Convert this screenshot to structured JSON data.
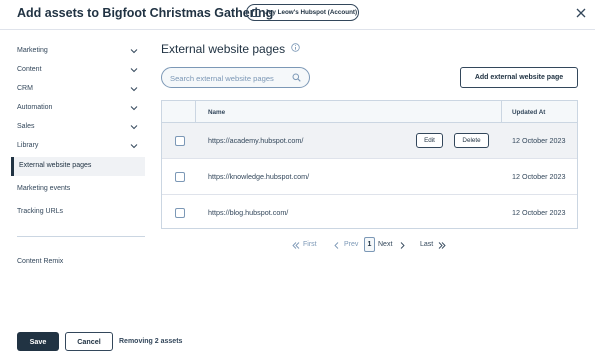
{
  "header": {
    "title": "Add assets to Bigfoot Christmas Gathering",
    "account_chip": "Joy Leow's Hubspot (Account)"
  },
  "sidebar": {
    "items": [
      {
        "label": "Marketing"
      },
      {
        "label": "Content"
      },
      {
        "label": "CRM"
      },
      {
        "label": "Automation"
      },
      {
        "label": "Sales"
      },
      {
        "label": "Library"
      }
    ],
    "active_item": "External website pages",
    "links": [
      {
        "label": "Marketing events"
      },
      {
        "label": "Tracking URLs"
      }
    ],
    "bottom_item": "Content Remix"
  },
  "main": {
    "title": "External website pages",
    "search": {
      "placeholder": "Search external website pages",
      "value": ""
    },
    "add_button": "Add external website page",
    "table": {
      "columns": [
        "Name",
        "Updated At"
      ],
      "rows": [
        {
          "url": "https://academy.hubspot.com/",
          "updated": "12 October 2023"
        },
        {
          "url": "https://knowledge.hubspot.com/",
          "updated": "12 October 2023"
        },
        {
          "url": "https://blog.hubspot.com/",
          "updated": "12 October 2023"
        }
      ],
      "row_actions": {
        "edit": "Edit",
        "delete": "Delete"
      }
    },
    "pagination": {
      "first": "First",
      "prev": "Prev",
      "current": "1",
      "next": "Next",
      "last": "Last"
    }
  },
  "footer": {
    "save": "Save",
    "cancel": "Cancel",
    "status": "Removing 2 assets"
  },
  "colors": {
    "primary_dark": "#213343",
    "text": "#33475b",
    "border": "#cbd6e2",
    "muted": "#7c98b6",
    "hover_bg": "#f0f2f5"
  }
}
